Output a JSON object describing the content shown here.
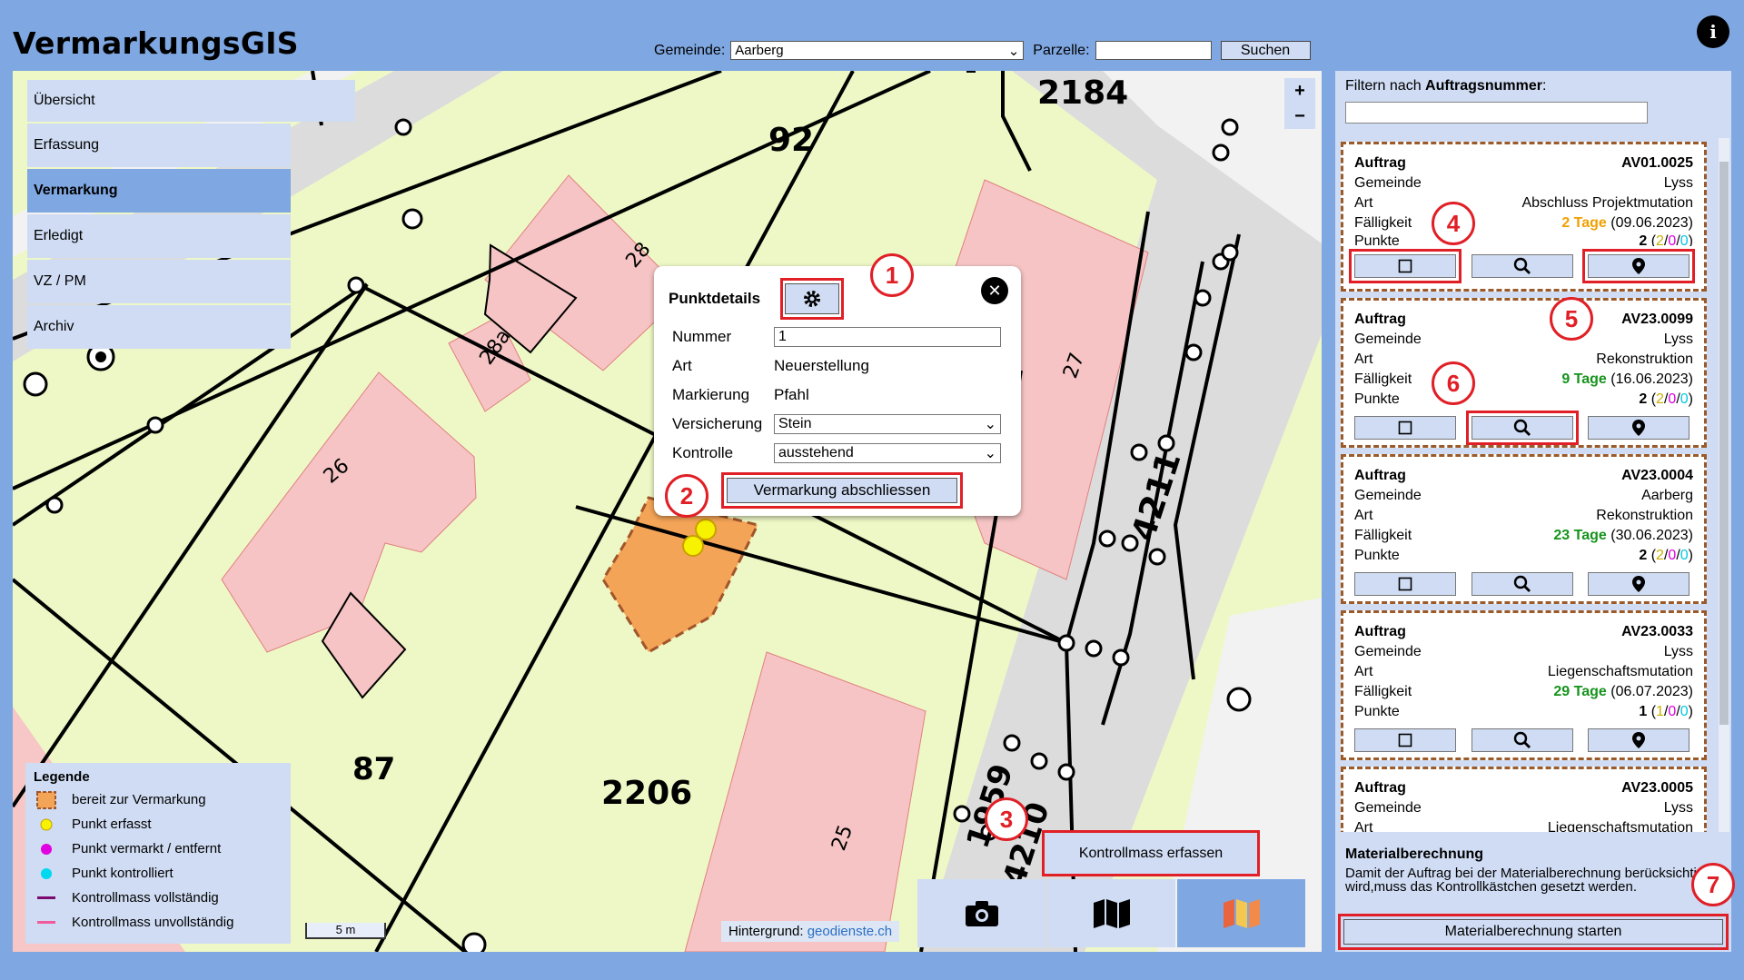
{
  "app": {
    "title": "VermarkungsGIS"
  },
  "search": {
    "gemeinde_label": "Gemeinde:",
    "gemeinde_value": "Aarberg",
    "parzelle_label": "Parzelle:",
    "parzelle_value": "",
    "button": "Suchen"
  },
  "info_icon": "info-icon",
  "nav": {
    "items": [
      {
        "label": "Übersicht"
      },
      {
        "label": "Erfassung"
      },
      {
        "label": "Vermarkung",
        "active": true
      },
      {
        "label": "Erledigt"
      },
      {
        "label": "VZ / PM"
      },
      {
        "label": "Archiv"
      }
    ]
  },
  "map": {
    "zoom_in": "+",
    "zoom_out": "−",
    "parcel_labels": [
      "2184",
      "92",
      "87",
      "2206",
      "4211",
      "1959",
      "4210"
    ],
    "building_labels": [
      "28",
      "28a",
      "26",
      "27",
      "25"
    ],
    "scale": "5 m",
    "background_label": "Hintergrund:",
    "background_link": "geodienste.ch"
  },
  "legend": {
    "title": "Legende",
    "items": [
      {
        "label": "bereit zur Vermarkung",
        "color": "#f4a457"
      },
      {
        "label": "Punkt erfasst",
        "color": "#f7f200"
      },
      {
        "label": "Punkt vermarkt / entfernt",
        "color": "#e000e0"
      },
      {
        "label": "Punkt kontrolliert",
        "color": "#00d8f0"
      },
      {
        "label": "Kontrollmass vollständig",
        "color": "#7a0a6e"
      },
      {
        "label": "Kontrollmass unvollständig",
        "color": "#f25a9c"
      }
    ]
  },
  "popup": {
    "title": "Punktdetails",
    "fields": [
      {
        "key": "Nummer",
        "value": "1"
      },
      {
        "key": "Art",
        "value": "Neuerstellung"
      },
      {
        "key": "Markierung",
        "value": "Pfahl"
      },
      {
        "key": "Versicherung",
        "value": "Stein"
      },
      {
        "key": "Kontrolle",
        "value": "ausstehend"
      }
    ],
    "button": "Vermarkung abschliessen"
  },
  "tools": {
    "kontrollmass": "Kontrollmass erfassen",
    "icons": [
      "camera-icon",
      "map-icon",
      "colored-map-icon"
    ]
  },
  "markers": [
    "1",
    "2",
    "3",
    "4",
    "5",
    "6",
    "7"
  ],
  "sidebar": {
    "filter_label_prefix": "Filtern nach ",
    "filter_label_bold": "Auftragsnummer",
    "filter_label_suffix": ":",
    "filter_value": "",
    "labels": {
      "auftrag": "Auftrag",
      "gemeinde": "Gemeinde",
      "art": "Art",
      "faelligkeit": "Fälligkeit",
      "punkte": "Punkte"
    },
    "orders": [
      {
        "id": "AV01.0025",
        "gemeinde": "Lyss",
        "art": "Abschluss Projektmutation",
        "due_days": "2 Tage",
        "due_date": "(09.06.2023)",
        "due_color": "#f0a000",
        "punkte": "2",
        "p1": "2",
        "p2": "0",
        "p3": "0"
      },
      {
        "id": "AV23.0099",
        "gemeinde": "Lyss",
        "art": "Rekonstruktion",
        "due_days": "9 Tage",
        "due_date": "(16.06.2023)",
        "due_color": "#16931c",
        "punkte": "2",
        "p1": "2",
        "p2": "0",
        "p3": "0"
      },
      {
        "id": "AV23.0004",
        "gemeinde": "Aarberg",
        "art": "Rekonstruktion",
        "due_days": "23 Tage",
        "due_date": "(30.06.2023)",
        "due_color": "#16931c",
        "punkte": "2",
        "p1": "2",
        "p2": "0",
        "p3": "0"
      },
      {
        "id": "AV23.0033",
        "gemeinde": "Lyss",
        "art": "Liegenschaftsmutation",
        "due_days": "29 Tage",
        "due_date": "(06.07.2023)",
        "due_color": "#16931c",
        "punkte": "1",
        "p1": "1",
        "p2": "0",
        "p3": "0"
      },
      {
        "id": "AV23.0005",
        "gemeinde": "Lyss",
        "art": "Liegenschaftsmutation"
      }
    ],
    "material": {
      "title": "Materialberechnung",
      "text": "Damit der Auftrag bei der Materialberechnung berücksichtigt wird,muss das Kontrollkästchen gesetzt werden.",
      "button": "Materialberechnung starten"
    }
  }
}
